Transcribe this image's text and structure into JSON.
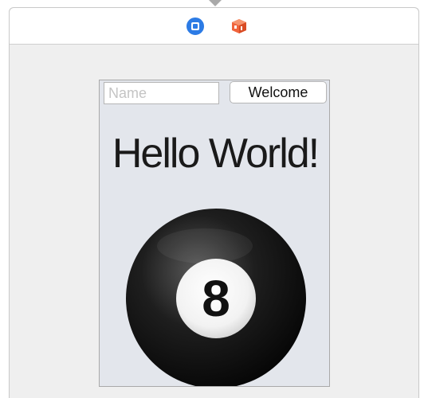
{
  "canvas": {
    "dock_icons": [
      "view-controller-icon",
      "first-responder-cube-icon"
    ]
  },
  "view": {
    "name_field": {
      "value": "",
      "placeholder": "Name"
    },
    "welcome_button": "Welcome",
    "hello_label": "Hello World!",
    "ball_image": {
      "icon": "eight-ball-icon",
      "number": "8"
    }
  },
  "colors": {
    "view_controller_icon": "#2c7be5",
    "cube_icon": "#f0643c",
    "device_background": "#e3e6ec"
  }
}
